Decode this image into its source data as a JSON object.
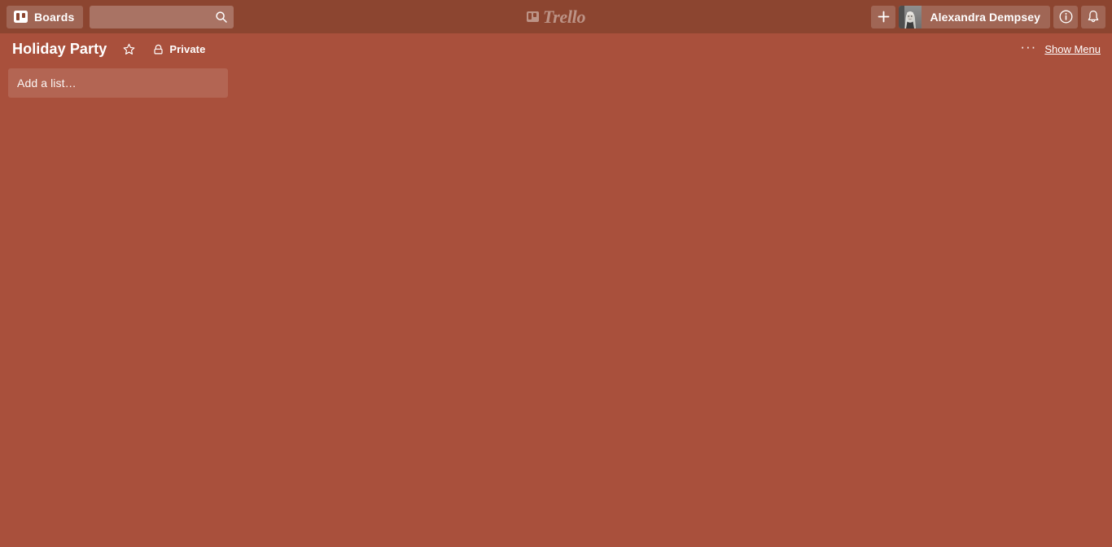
{
  "colors": {
    "board_background": "#a9503c",
    "header_background": "#8c4530",
    "text": "#ffffff"
  },
  "top_bar": {
    "boards_button": {
      "label": "Boards",
      "icon": "board-icon"
    },
    "search": {
      "value": "",
      "placeholder": "",
      "icon": "search-icon"
    },
    "logo": {
      "wordmark": "Trello",
      "icon": "trello-logo-icon"
    },
    "add_button": {
      "label": "+",
      "icon": "plus-icon"
    },
    "member": {
      "name": "Alexandra Dempsey",
      "avatar": "user-avatar"
    },
    "info_button": {
      "icon": "info-icon"
    },
    "notifications_button": {
      "icon": "bell-icon"
    }
  },
  "board_header": {
    "title": "Holiday Party",
    "star": {
      "icon": "star-icon",
      "starred": false
    },
    "visibility": {
      "label": "Private",
      "icon": "lock-icon"
    },
    "options": {
      "label": "···"
    },
    "show_menu": {
      "label": "Show Menu"
    }
  },
  "board": {
    "lists": [],
    "add_list": {
      "label": "Add a list…"
    }
  }
}
